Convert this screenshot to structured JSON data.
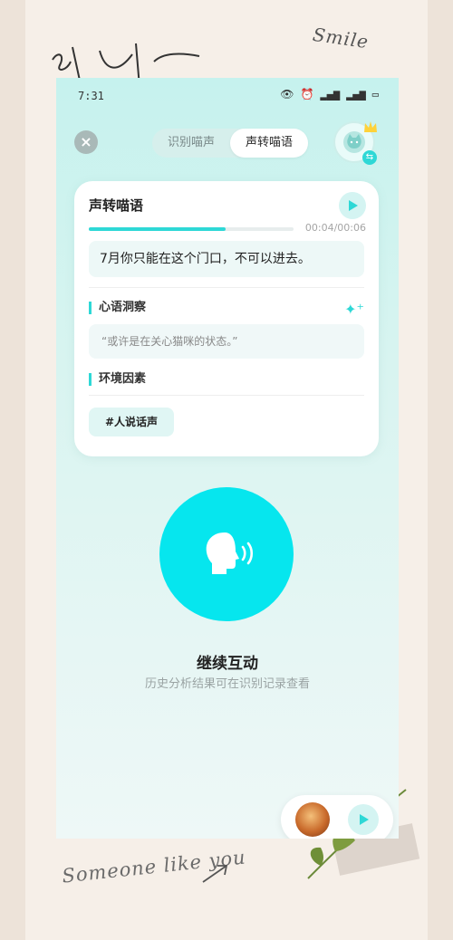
{
  "status_bar": {
    "time": "7:31"
  },
  "header": {
    "tabs": [
      {
        "label": "识别喵声",
        "active": false
      },
      {
        "label": "声转喵语",
        "active": true
      }
    ]
  },
  "card": {
    "title": "声转喵语",
    "playback": {
      "time_readout": "00:04/00:06",
      "progress_fraction": 0.67
    },
    "translation": "7月你只能在这个门口，不可以进去。",
    "insight_section": {
      "title": "心语洞察",
      "text": "“或许是在关心猫咪的状态。”"
    },
    "environment_section": {
      "title": "环境因素",
      "tag": "#人说话声"
    }
  },
  "action": {
    "button_label": "继续互动",
    "hint": "历史分析结果可在识别记录查看"
  },
  "decor": {
    "smile_text": "Smile",
    "someone_text": "Someone like you"
  },
  "colors": {
    "accent": "#2ed8d6",
    "big_button": "#06e6ee"
  },
  "icons": [
    "close-icon",
    "cat-avatar-icon",
    "crown-icon",
    "swap-icon",
    "play-icon",
    "sparkle-icon",
    "speaking-head-icon"
  ]
}
